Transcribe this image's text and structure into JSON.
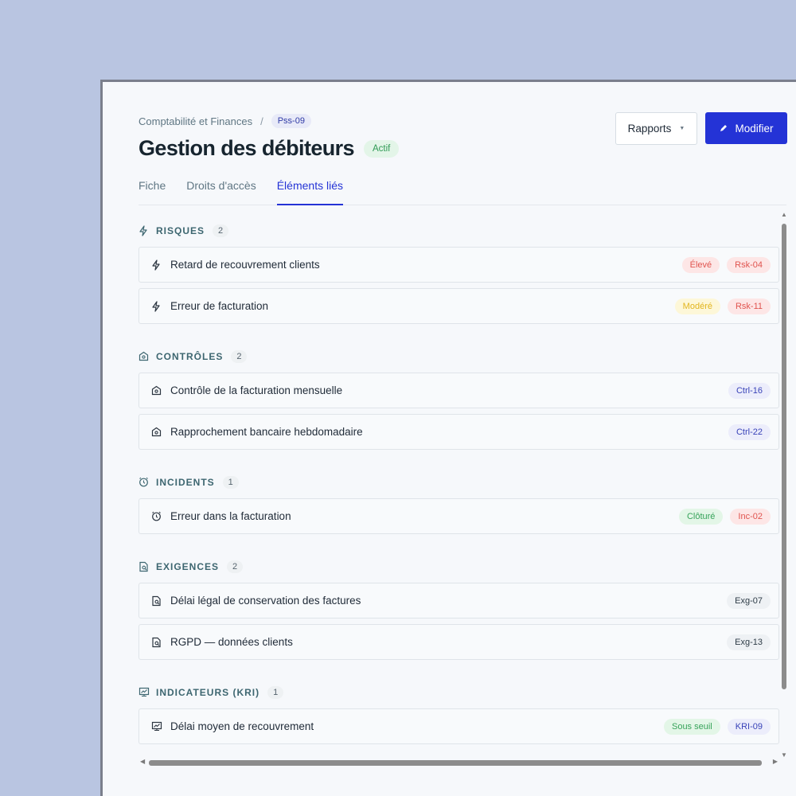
{
  "breadcrumb": {
    "parent": "Comptabilité et Finances",
    "separator": "/",
    "code": "Pss-09"
  },
  "page": {
    "title": "Gestion des débiteurs",
    "status": "Actif"
  },
  "actions": {
    "reports_label": "Rapports",
    "edit_label": "Modifier"
  },
  "tabs": [
    {
      "label": "Fiche",
      "active": false
    },
    {
      "label": "Droits d'accès",
      "active": false
    },
    {
      "label": "Éléments liés",
      "active": true
    }
  ],
  "sections": {
    "risques": {
      "title": "RISQUES",
      "count": "2",
      "icon": "lightning-icon",
      "items": [
        {
          "label": "Retard de recouvrement clients",
          "tags": [
            "Élevé",
            "Rsk-04"
          ]
        },
        {
          "label": "Erreur de facturation",
          "tags": [
            "Modéré",
            "Rsk-11"
          ]
        }
      ]
    },
    "controles": {
      "title": "CONTRÔLES",
      "count": "2",
      "icon": "shield-home-icon",
      "items": [
        {
          "label": "Contrôle de la facturation mensuelle",
          "tags": [
            "Ctrl-16"
          ]
        },
        {
          "label": "Rapprochement bancaire hebdomadaire",
          "tags": [
            "Ctrl-22"
          ]
        }
      ]
    },
    "incidents": {
      "title": "INCIDENTS",
      "count": "1",
      "icon": "alarm-clock-icon",
      "items": [
        {
          "label": "Erreur dans la facturation",
          "tags": [
            "Clôturé",
            "Inc-02"
          ]
        }
      ]
    },
    "exigences": {
      "title": "EXIGENCES",
      "count": "2",
      "icon": "document-search-icon",
      "items": [
        {
          "label": "Délai légal de conservation des factures",
          "tags": [
            "Exg-07"
          ]
        },
        {
          "label": "RGPD — données clients",
          "tags": [
            "Exg-13"
          ]
        }
      ]
    },
    "indicateurs": {
      "title": "INDICATEURS (KRI)",
      "count": "1",
      "icon": "monitor-chart-icon",
      "items": [
        {
          "label": "Délai moyen de recouvrement",
          "tags": [
            "Sous seuil",
            "KRI-09"
          ]
        }
      ]
    }
  },
  "colors": {
    "accent": "#2433d6",
    "background": "#b9c5e1",
    "danger": "#e0544f",
    "warning": "#e2b51e",
    "success": "#37a35a"
  }
}
